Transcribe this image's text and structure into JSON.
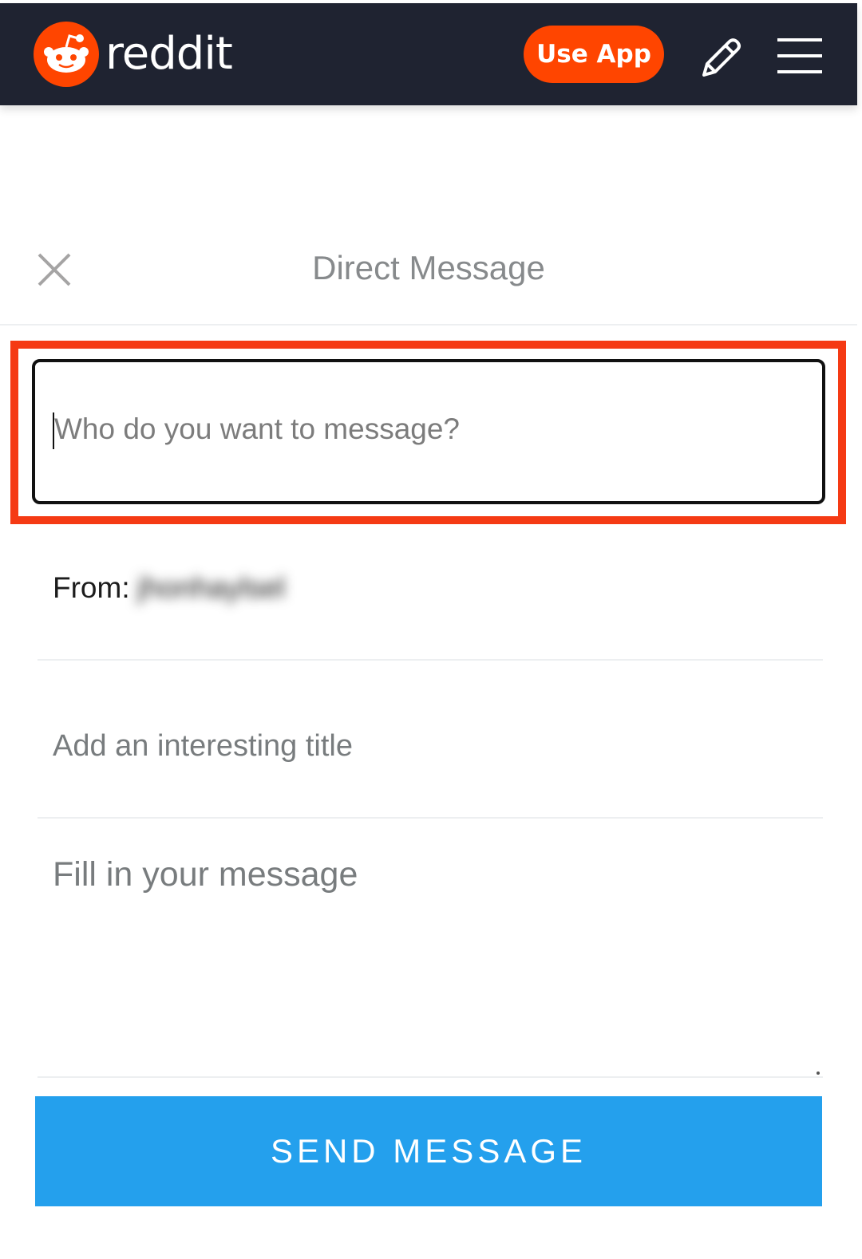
{
  "header": {
    "brand": "reddit",
    "use_app_label": "Use App",
    "icons": [
      "reddit-logo-icon",
      "pencil-icon",
      "hamburger-menu-icon"
    ]
  },
  "dialog": {
    "title": "Direct Message",
    "close_icon": "close-icon"
  },
  "form": {
    "to_placeholder": "Who do you want to message?",
    "from_label": "From:",
    "from_username": "jhonhaylsel",
    "title_placeholder": "Add an interesting title",
    "message_placeholder": "Fill in your message",
    "send_label": "SEND MESSAGE"
  },
  "colors": {
    "header_bg": "#1f2331",
    "brand_orange": "#ff4500",
    "highlight_red": "#f53a14",
    "send_blue": "#24a0ed"
  }
}
